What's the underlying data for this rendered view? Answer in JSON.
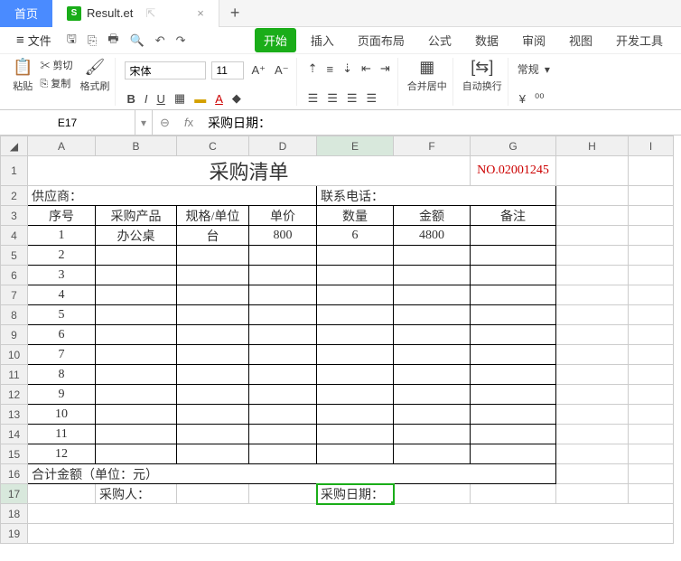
{
  "tabs": {
    "home": "首页",
    "file": "Result.et",
    "plus": "+"
  },
  "filemenu": "文件",
  "menu": {
    "start": "开始",
    "insert": "插入",
    "layout": "页面布局",
    "formula": "公式",
    "data": "数据",
    "review": "审阅",
    "view": "视图",
    "dev": "开发工具"
  },
  "ribbon": {
    "paste": "粘贴",
    "cut": "剪切",
    "copy": "复制",
    "format_painter": "格式刷",
    "font_name": "宋体",
    "font_size": "11",
    "merge": "合并居中",
    "wrap": "自动换行",
    "general": "常规"
  },
  "name_box": "E17",
  "formula": "采购日期：",
  "cols": [
    "A",
    "B",
    "C",
    "D",
    "E",
    "F",
    "G",
    "H",
    "I"
  ],
  "title": "采购清单",
  "doc_no": "NO.02001245",
  "supplier_label": "供应商：",
  "contact_label": "联系电话：",
  "headers": {
    "seq": "序号",
    "product": "采购产品",
    "spec": "规格/单位",
    "price": "单价",
    "qty": "数量",
    "amount": "金额",
    "note": "备注"
  },
  "rows": [
    {
      "seq": "1",
      "product": "办公桌",
      "spec": "台",
      "price": "800",
      "qty": "6",
      "amount": "4800",
      "note": ""
    },
    {
      "seq": "2"
    },
    {
      "seq": "3"
    },
    {
      "seq": "4"
    },
    {
      "seq": "5"
    },
    {
      "seq": "6"
    },
    {
      "seq": "7"
    },
    {
      "seq": "8"
    },
    {
      "seq": "9"
    },
    {
      "seq": "10"
    },
    {
      "seq": "11"
    },
    {
      "seq": "12"
    }
  ],
  "total_label": "合计金额（单位：元）",
  "buyer_label": "采购人：",
  "date_label": "采购日期："
}
